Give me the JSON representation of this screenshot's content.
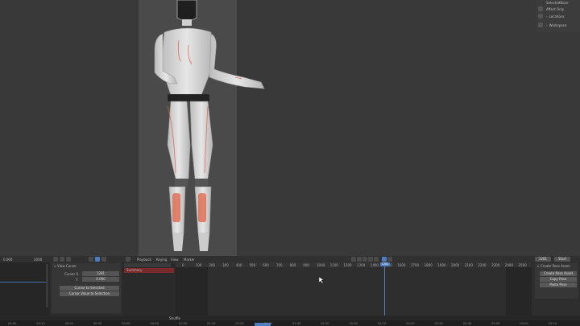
{
  "npanel": {
    "top_label": "SelectedBone",
    "rows": [
      "Affect Only",
      "Locations"
    ],
    "section": "Workspace"
  },
  "graph_sidebar": {
    "left_value": "0.000",
    "right_value": "2000",
    "panel_title": "View Cursor",
    "cursor_x_label": "Cursor X",
    "cursor_x_value": "1281",
    "y_label": "Y",
    "y_value": "0.000",
    "button1": "Cursor to Selected",
    "button2": "Cursor Value to Selection"
  },
  "dopesheet": {
    "menu": [
      "Playback",
      "Keying",
      "View",
      "Marker"
    ],
    "summary_label": "Summary",
    "ruler": [
      "0",
      "100",
      "200",
      "300",
      "400",
      "500",
      "600",
      "700",
      "800",
      "900",
      "1000",
      "1100",
      "1200",
      "1300",
      "1400",
      "1500",
      "1600",
      "1700",
      "1800",
      "1900",
      "2000",
      "2100",
      "2200",
      "2300",
      "2400",
      "2500"
    ],
    "current_frame": "1281",
    "start_label": "1281",
    "end_label": "Start"
  },
  "right_panel": {
    "section": "Create Pose Asset",
    "rows": [
      "Create Pose Asset",
      "Copy Pose",
      "Paste Pose"
    ]
  },
  "footer": {
    "menu_label": "Shuffle",
    "ticks": [
      "00:00",
      "00:10",
      "00:20",
      "00:30",
      "00:40",
      "00:50",
      "01:00",
      "01:10",
      "01:20",
      "01:30",
      "01:40",
      "01:50",
      "02:00",
      "02:10",
      "02:20",
      "02:30",
      "02:40",
      "02:50",
      "03:00",
      "03:10"
    ]
  },
  "colors": {
    "accent": "#4f7dc2",
    "body_fill": "#d8d8d8",
    "glow": "#e25a3a",
    "summary": "#7a2a2a"
  }
}
